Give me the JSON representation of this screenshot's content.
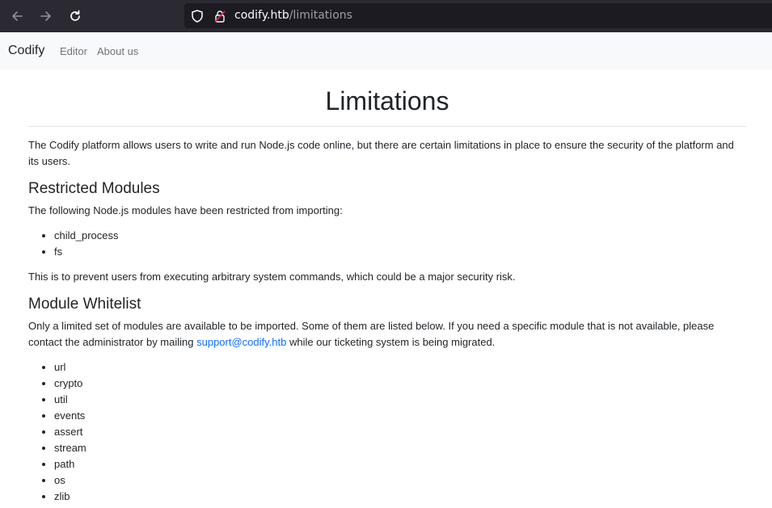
{
  "browser": {
    "url_host": "codify.htb",
    "url_path": "/limitations"
  },
  "navbar": {
    "brand": "Codify",
    "links": [
      {
        "label": "Editor"
      },
      {
        "label": "About us"
      }
    ]
  },
  "page": {
    "title": "Limitations",
    "intro": "The Codify platform allows users to write and run Node.js code online, but there are certain limitations in place to ensure the security of the platform and its users.",
    "restricted": {
      "heading": "Restricted Modules",
      "text": "The following Node.js modules have been restricted from importing:",
      "items": [
        "child_process",
        "fs"
      ],
      "note": "This is to prevent users from executing arbitrary system commands, which could be a major security risk."
    },
    "whitelist": {
      "heading": "Module Whitelist",
      "text_before": "Only a limited set of modules are available to be imported. Some of them are listed below. If you need a specific module that is not available, please contact the administrator by mailing ",
      "email": "support@codify.htb",
      "text_after": " while our ticketing system is being migrated.",
      "items": [
        "url",
        "crypto",
        "util",
        "events",
        "assert",
        "stream",
        "path",
        "os",
        "zlib"
      ]
    }
  },
  "colors": {
    "chrome_bg": "#2b2a33",
    "urlbar_bg": "#1c1b22",
    "navbar_bg": "#f8f9fa",
    "link": "#0d6efd"
  }
}
